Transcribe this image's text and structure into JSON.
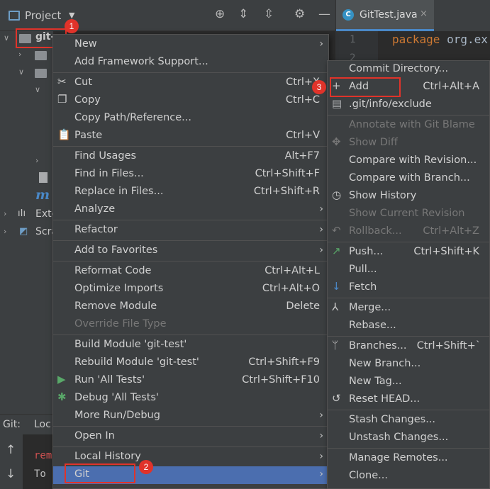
{
  "toolbar": {
    "project_label": "Project",
    "icons": [
      "target-icon",
      "expand-all-icon",
      "collapse-all-icon",
      "gear-icon",
      "minimize-icon"
    ]
  },
  "editor_tab": {
    "label": "GitTest.java",
    "close": "×"
  },
  "tree": {
    "root": "git-",
    "items": [
      "Exte",
      "Scra"
    ]
  },
  "git_panel": {
    "label": "Git:",
    "tab": "Loc",
    "log_lines": [
      "rem",
      "To"
    ]
  },
  "editor": {
    "line_numbers": [
      "1",
      "2"
    ],
    "code_keyword": "package",
    "code_rest": "org.ex"
  },
  "menu1": {
    "items": [
      {
        "label": "New",
        "shortcut": "",
        "submenu": true
      },
      {
        "label": "Add Framework Support...",
        "shortcut": ""
      },
      {
        "label": "Cut",
        "shortcut": "Ctrl+X",
        "icon": "scissors-icon"
      },
      {
        "label": "Copy",
        "shortcut": "Ctrl+C",
        "icon": "copy-icon"
      },
      {
        "label": "Copy Path/Reference...",
        "shortcut": ""
      },
      {
        "label": "Paste",
        "shortcut": "Ctrl+V",
        "icon": "paste-icon"
      },
      {
        "label": "Find Usages",
        "shortcut": "Alt+F7"
      },
      {
        "label": "Find in Files...",
        "shortcut": "Ctrl+Shift+F"
      },
      {
        "label": "Replace in Files...",
        "shortcut": "Ctrl+Shift+R"
      },
      {
        "label": "Analyze",
        "shortcut": "",
        "submenu": true
      },
      {
        "label": "Refactor",
        "shortcut": "",
        "submenu": true
      },
      {
        "label": "Add to Favorites",
        "shortcut": "",
        "submenu": true
      },
      {
        "label": "Reformat Code",
        "shortcut": "Ctrl+Alt+L"
      },
      {
        "label": "Optimize Imports",
        "shortcut": "Ctrl+Alt+O"
      },
      {
        "label": "Remove Module",
        "shortcut": "Delete"
      },
      {
        "label": "Override File Type",
        "shortcut": "",
        "disabled": true
      },
      {
        "label": "Build Module 'git-test'",
        "shortcut": ""
      },
      {
        "label": "Rebuild Module 'git-test'",
        "shortcut": "Ctrl+Shift+F9"
      },
      {
        "label": "Run 'All Tests'",
        "shortcut": "Ctrl+Shift+F10",
        "icon": "run-icon"
      },
      {
        "label": "Debug 'All Tests'",
        "shortcut": "",
        "icon": "debug-icon"
      },
      {
        "label": "More Run/Debug",
        "shortcut": "",
        "submenu": true
      },
      {
        "label": "Open In",
        "shortcut": "",
        "submenu": true
      },
      {
        "label": "Local History",
        "shortcut": "",
        "submenu": true
      },
      {
        "label": "Git",
        "shortcut": "",
        "submenu": true,
        "highlighted": true
      }
    ]
  },
  "menu2": {
    "items": [
      {
        "label": "Commit Directory...",
        "shortcut": ""
      },
      {
        "label": "Add",
        "shortcut": "Ctrl+Alt+A",
        "icon": "plus-icon"
      },
      {
        "label": ".git/info/exclude",
        "shortcut": "",
        "icon": "file-icon"
      },
      {
        "label": "Annotate with Git Blame",
        "shortcut": "",
        "disabled": true
      },
      {
        "label": "Show Diff",
        "shortcut": "",
        "disabled": true,
        "icon": "diff-icon"
      },
      {
        "label": "Compare with Revision...",
        "shortcut": ""
      },
      {
        "label": "Compare with Branch...",
        "shortcut": ""
      },
      {
        "label": "Show History",
        "shortcut": "",
        "icon": "clock-icon"
      },
      {
        "label": "Show Current Revision",
        "shortcut": "",
        "disabled": true
      },
      {
        "label": "Rollback...",
        "shortcut": "Ctrl+Alt+Z",
        "disabled": true,
        "icon": "rollback-icon"
      },
      {
        "label": "Push...",
        "shortcut": "Ctrl+Shift+K",
        "icon": "push-icon"
      },
      {
        "label": "Pull...",
        "shortcut": ""
      },
      {
        "label": "Fetch",
        "shortcut": "",
        "icon": "fetch-icon"
      },
      {
        "label": "Merge...",
        "shortcut": "",
        "icon": "merge-icon"
      },
      {
        "label": "Rebase...",
        "shortcut": ""
      },
      {
        "label": "Branches...",
        "shortcut": "Ctrl+Shift+`",
        "icon": "branch-icon"
      },
      {
        "label": "New Branch...",
        "shortcut": ""
      },
      {
        "label": "New Tag...",
        "shortcut": ""
      },
      {
        "label": "Reset HEAD...",
        "shortcut": "",
        "icon": "reset-icon"
      },
      {
        "label": "Stash Changes...",
        "shortcut": ""
      },
      {
        "label": "Unstash Changes...",
        "shortcut": ""
      },
      {
        "label": "Manage Remotes...",
        "shortcut": ""
      },
      {
        "label": "Clone...",
        "shortcut": ""
      }
    ]
  },
  "badges": [
    "1",
    "2",
    "3"
  ],
  "colors": {
    "annotation": "#e0332a",
    "highlight": "#4b6eaf",
    "menu_bg": "#3c3f41"
  }
}
